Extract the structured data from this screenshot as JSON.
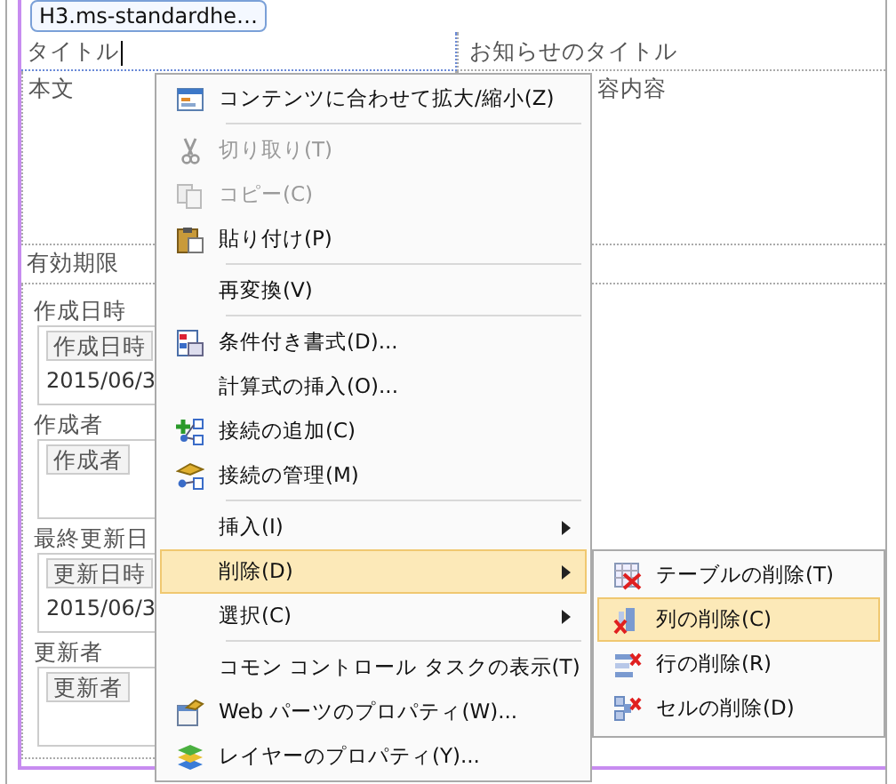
{
  "tag_label": "H3.ms-standardhe…",
  "title_row": {
    "label": "タイトル",
    "value": "お知らせのタイトル"
  },
  "body_row": {
    "label": "本文",
    "value": "容内容"
  },
  "expiry_label": "有効期限",
  "fields": [
    {
      "label": "作成日時",
      "header": "作成日時",
      "value": "2015/06/3"
    },
    {
      "label": "作成者",
      "header": "作成者"
    },
    {
      "label": "最終更新日",
      "header": "更新日時",
      "value": "2015/06/3"
    },
    {
      "label": "更新者",
      "header": "更新者"
    }
  ],
  "context_menu": {
    "items": [
      {
        "label": "コンテンツに合わせて拡大/縮小(Z)",
        "disabled": false,
        "selected": false,
        "submenu": false,
        "separator_after": true
      },
      {
        "label": "切り取り(T)",
        "disabled": true,
        "selected": false,
        "submenu": false,
        "separator_after": false
      },
      {
        "label": "コピー(C)",
        "disabled": true,
        "selected": false,
        "submenu": false,
        "separator_after": false
      },
      {
        "label": "貼り付け(P)",
        "disabled": false,
        "selected": false,
        "submenu": false,
        "separator_after": true
      },
      {
        "label": "再変換(V)",
        "disabled": false,
        "selected": false,
        "submenu": false,
        "separator_after": true
      },
      {
        "label": "条件付き書式(D)...",
        "disabled": false,
        "selected": false,
        "submenu": false,
        "separator_after": false
      },
      {
        "label": "計算式の挿入(O)...",
        "disabled": false,
        "selected": false,
        "submenu": false,
        "separator_after": false
      },
      {
        "label": "接続の追加(C)",
        "disabled": false,
        "selected": false,
        "submenu": false,
        "separator_after": false
      },
      {
        "label": "接続の管理(M)",
        "disabled": false,
        "selected": false,
        "submenu": false,
        "separator_after": true
      },
      {
        "label": "挿入(I)",
        "disabled": false,
        "selected": false,
        "submenu": true,
        "separator_after": false
      },
      {
        "label": "削除(D)",
        "disabled": false,
        "selected": true,
        "submenu": true,
        "separator_after": false
      },
      {
        "label": "選択(C)",
        "disabled": false,
        "selected": false,
        "submenu": true,
        "separator_after": true
      },
      {
        "label": "コモン コントロール タスクの表示(T)",
        "disabled": false,
        "selected": false,
        "submenu": false,
        "separator_after": false
      },
      {
        "label": "Web パーツのプロパティ(W)...",
        "disabled": false,
        "selected": false,
        "submenu": false,
        "separator_after": false
      },
      {
        "label": "レイヤーのプロパティ(Y)...",
        "disabled": false,
        "selected": false,
        "submenu": false,
        "separator_after": false
      }
    ]
  },
  "submenu": {
    "items": [
      {
        "label": "テーブルの削除(T)",
        "selected": false
      },
      {
        "label": "列の削除(C)",
        "selected": true
      },
      {
        "label": "行の削除(R)",
        "selected": false
      },
      {
        "label": "セルの削除(D)",
        "selected": false
      }
    ]
  }
}
